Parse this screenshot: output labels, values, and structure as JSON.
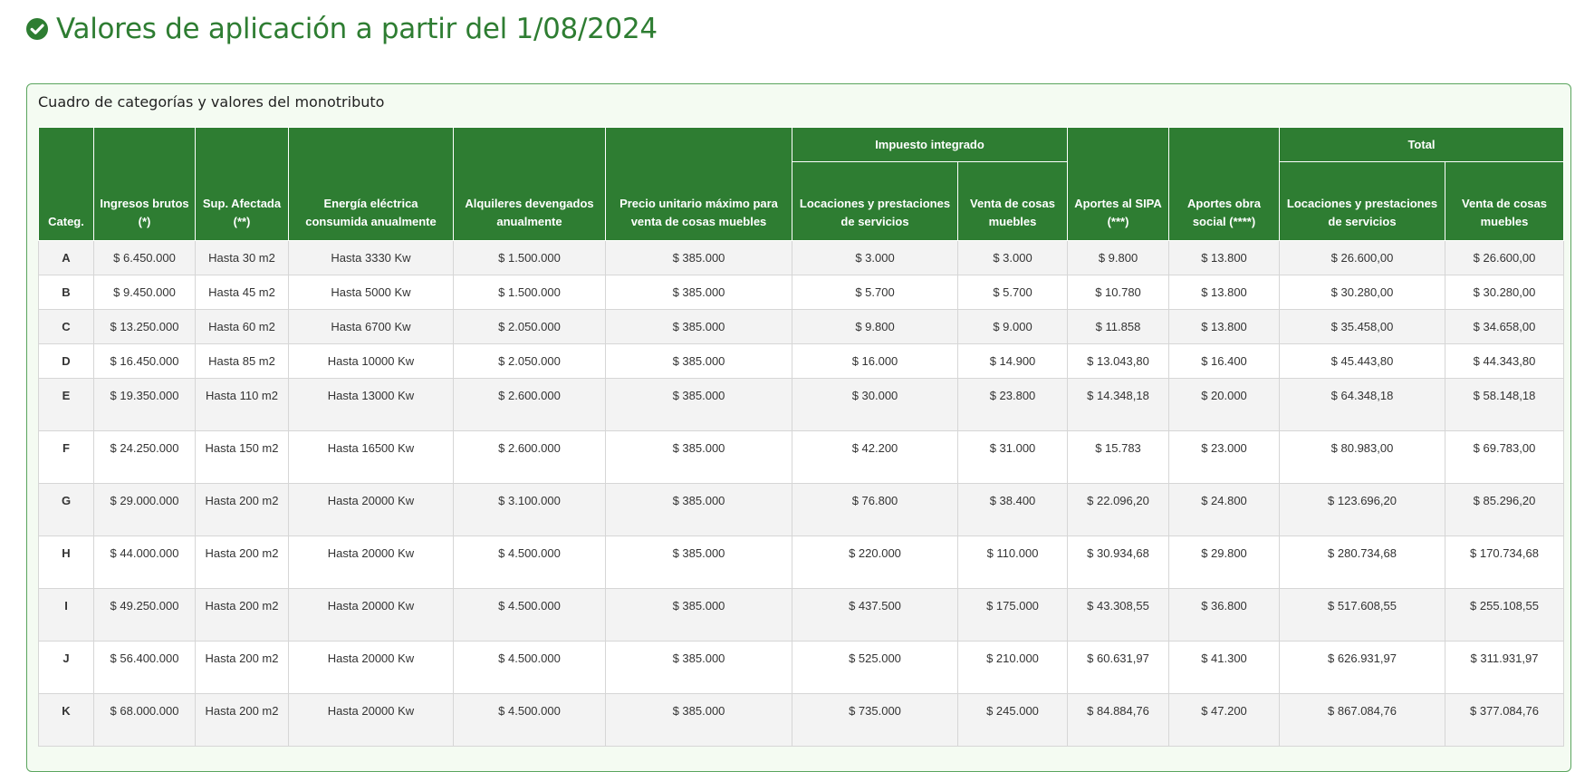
{
  "page": {
    "title": "Valores de aplicación a partir del 1/08/2024",
    "title_icon": "check-circle-icon",
    "accent_color": "#2e7d32"
  },
  "panel": {
    "heading": "Cuadro de categorías y valores del monotributo"
  },
  "table": {
    "group_headers": {
      "impuesto": "Impuesto integrado",
      "total": "Total"
    },
    "headers": {
      "categ": "Categ.",
      "ingresos": "Ingresos brutos (*)",
      "sup": "Sup. Afectada (**)",
      "energia": "Energía eléctrica consumida anualmente",
      "alquileres": "Alquileres devengados anualmente",
      "precio": "Precio unitario máximo para venta de cosas muebles",
      "imp_loc": "Locaciones y prestaciones de servicios",
      "imp_venta": "Venta de cosas muebles",
      "sipa": "Aportes al SIPA (***)",
      "obra": "Aportes obra social (****)",
      "tot_loc": "Locaciones y prestaciones de servicios",
      "tot_venta": "Venta de cosas muebles"
    },
    "rows": [
      [
        "A",
        "$ 6.450.000",
        "Hasta 30 m2",
        "Hasta 3330 Kw",
        "$ 1.500.000",
        "$ 385.000",
        "$ 3.000",
        "$ 3.000",
        "$ 9.800",
        "$ 13.800",
        "$ 26.600,00",
        "$ 26.600,00"
      ],
      [
        "B",
        "$ 9.450.000",
        "Hasta 45 m2",
        "Hasta 5000 Kw",
        "$ 1.500.000",
        "$ 385.000",
        "$ 5.700",
        "$ 5.700",
        "$ 10.780",
        "$ 13.800",
        "$ 30.280,00",
        "$ 30.280,00"
      ],
      [
        "C",
        "$ 13.250.000",
        "Hasta 60 m2",
        "Hasta 6700 Kw",
        "$ 2.050.000",
        "$ 385.000",
        "$ 9.800",
        "$ 9.000",
        "$ 11.858",
        "$ 13.800",
        "$ 35.458,00",
        "$ 34.658,00"
      ],
      [
        "D",
        "$ 16.450.000",
        "Hasta 85 m2",
        "Hasta 10000 Kw",
        "$ 2.050.000",
        "$ 385.000",
        "$ 16.000",
        "$ 14.900",
        "$ 13.043,80",
        "$ 16.400",
        "$ 45.443,80",
        "$ 44.343,80"
      ],
      [
        "E",
        "$ 19.350.000",
        "Hasta 110 m2",
        "Hasta 13000 Kw",
        "$ 2.600.000",
        "$ 385.000",
        "$ 30.000",
        "$ 23.800",
        "$ 14.348,18",
        "$ 20.000",
        "$ 64.348,18",
        "$ 58.148,18"
      ],
      [
        "F",
        "$ 24.250.000",
        "Hasta 150 m2",
        "Hasta 16500 Kw",
        "$ 2.600.000",
        "$ 385.000",
        "$ 42.200",
        "$ 31.000",
        "$ 15.783",
        "$ 23.000",
        "$ 80.983,00",
        "$ 69.783,00"
      ],
      [
        "G",
        "$ 29.000.000",
        "Hasta 200 m2",
        "Hasta 20000 Kw",
        "$ 3.100.000",
        "$ 385.000",
        "$ 76.800",
        "$ 38.400",
        "$ 22.096,20",
        "$ 24.800",
        "$ 123.696,20",
        "$ 85.296,20"
      ],
      [
        "H",
        "$ 44.000.000",
        "Hasta 200 m2",
        "Hasta 20000 Kw",
        "$ 4.500.000",
        "$ 385.000",
        "$ 220.000",
        "$ 110.000",
        "$ 30.934,68",
        "$ 29.800",
        "$ 280.734,68",
        "$ 170.734,68"
      ],
      [
        "I",
        "$ 49.250.000",
        "Hasta 200 m2",
        "Hasta 20000 Kw",
        "$ 4.500.000",
        "$ 385.000",
        "$ 437.500",
        "$ 175.000",
        "$ 43.308,55",
        "$ 36.800",
        "$ 517.608,55",
        "$ 255.108,55"
      ],
      [
        "J",
        "$ 56.400.000",
        "Hasta 200 m2",
        "Hasta 20000 Kw",
        "$ 4.500.000",
        "$ 385.000",
        "$ 525.000",
        "$ 210.000",
        "$ 60.631,97",
        "$ 41.300",
        "$ 626.931,97",
        "$ 311.931,97"
      ],
      [
        "K",
        "$ 68.000.000",
        "Hasta 200 m2",
        "Hasta 20000 Kw",
        "$ 4.500.000",
        "$ 385.000",
        "$ 735.000",
        "$ 245.000",
        "$ 84.884,76",
        "$ 47.200",
        "$ 867.084,76",
        "$ 377.084,76"
      ]
    ]
  }
}
